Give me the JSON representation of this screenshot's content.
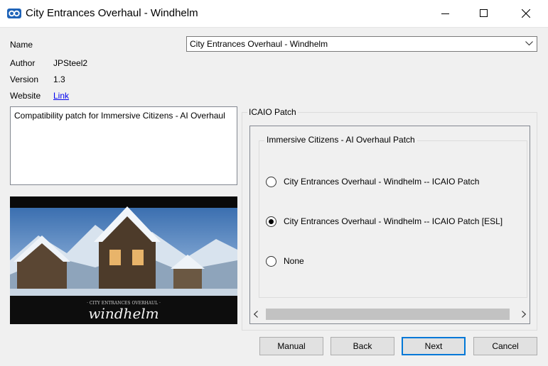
{
  "window": {
    "title": "City Entrances Overhaul - Windhelm",
    "icons": [
      "app-logo-icon",
      "minimize-icon",
      "maximize-icon",
      "close-icon"
    ]
  },
  "info": {
    "name_label": "Name",
    "name_value": "City Entrances Overhaul - Windhelm",
    "author_label": "Author",
    "author_value": "JPSteel2",
    "version_label": "Version",
    "version_value": "1.3",
    "website_label": "Website",
    "website_value": "Link"
  },
  "description": "Compatibility patch for Immersive Citizens - AI Overhaul",
  "preview": {
    "caption_small": "· CITY ENTRANCES OVERHAUL ·",
    "caption_big": "windhelm"
  },
  "patch_group": {
    "title": "ICAIO Patch",
    "inner_title": "Immersive Citizens - AI Overhaul Patch",
    "options": [
      {
        "label": "City Entrances Overhaul - Windhelm -- ICAIO Patch",
        "selected": false
      },
      {
        "label": "City Entrances Overhaul - Windhelm -- ICAIO Patch [ESL]",
        "selected": true
      },
      {
        "label": "None",
        "selected": false
      }
    ]
  },
  "buttons": {
    "manual": "Manual",
    "back": "Back",
    "next": "Next",
    "cancel": "Cancel"
  },
  "colors": {
    "accent": "#0078d7",
    "link": "#0000ee",
    "window_bg": "#f0f0f0"
  }
}
